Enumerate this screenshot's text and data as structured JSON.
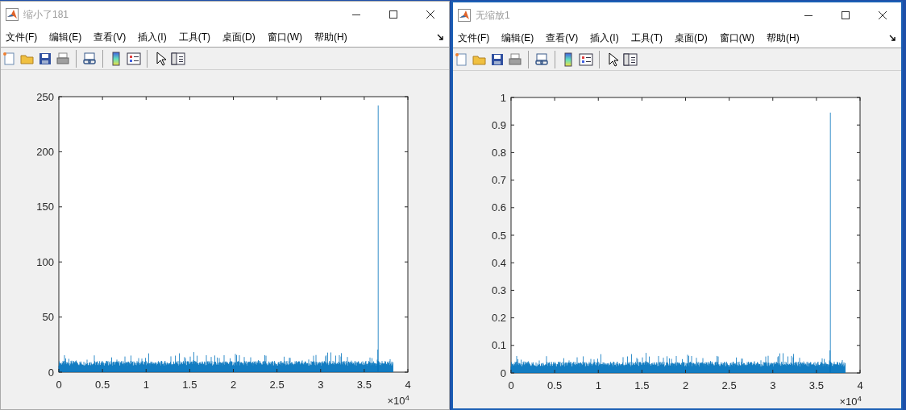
{
  "windows": [
    {
      "title": "缩小了181",
      "menu": [
        "文件(F)",
        "编辑(E)",
        "查看(V)",
        "插入(I)",
        "工具(T)",
        "桌面(D)",
        "窗口(W)",
        "帮助(H)"
      ],
      "active": false,
      "axes": {
        "yticks": [
          "250",
          "200",
          "150",
          "100",
          "50",
          "0"
        ],
        "xticks": [
          "0",
          "0.5",
          "1",
          "1.5",
          "2",
          "2.5",
          "3",
          "3.5",
          "4"
        ],
        "x_exponent": "×10$^{4}$"
      }
    },
    {
      "title": "无缩放1",
      "menu": [
        "文件(F)",
        "编辑(E)",
        "查看(V)",
        "插入(I)",
        "工具(T)",
        "桌面(D)",
        "窗口(W)",
        "帮助(H)"
      ],
      "active": true,
      "axes": {
        "yticks": [
          "1",
          "0.9",
          "0.8",
          "0.7",
          "0.6",
          "0.5",
          "0.4",
          "0.3",
          "0.2",
          "0.1",
          "0"
        ],
        "xticks": [
          "0",
          "0.5",
          "1",
          "1.5",
          "2",
          "2.5",
          "3",
          "3.5",
          "4"
        ],
        "x_exponent": "×10$^{4}$"
      }
    }
  ]
}
